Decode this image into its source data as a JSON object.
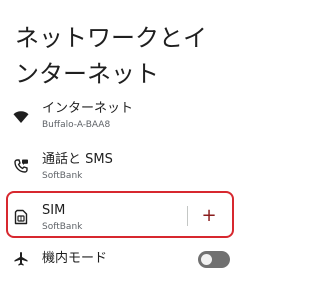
{
  "page": {
    "title": "ネットワークとインターネット"
  },
  "items": {
    "internet": {
      "title": "インターネット",
      "subtitle": "Buffalo-A-BAA8",
      "icon": "wifi-icon"
    },
    "calls_sms": {
      "title": "通話と SMS",
      "subtitle": "SoftBank",
      "icon": "phone-sms-icon"
    },
    "sim": {
      "title": "SIM",
      "subtitle": "SoftBank",
      "icon": "sim-card-icon",
      "add_label": "+"
    },
    "airplane": {
      "title": "機内モード",
      "icon": "airplane-icon",
      "enabled": false
    }
  },
  "colors": {
    "highlight": "#d7282f",
    "add_icon": "#8a1c1c",
    "toggle_off": "#707070"
  }
}
